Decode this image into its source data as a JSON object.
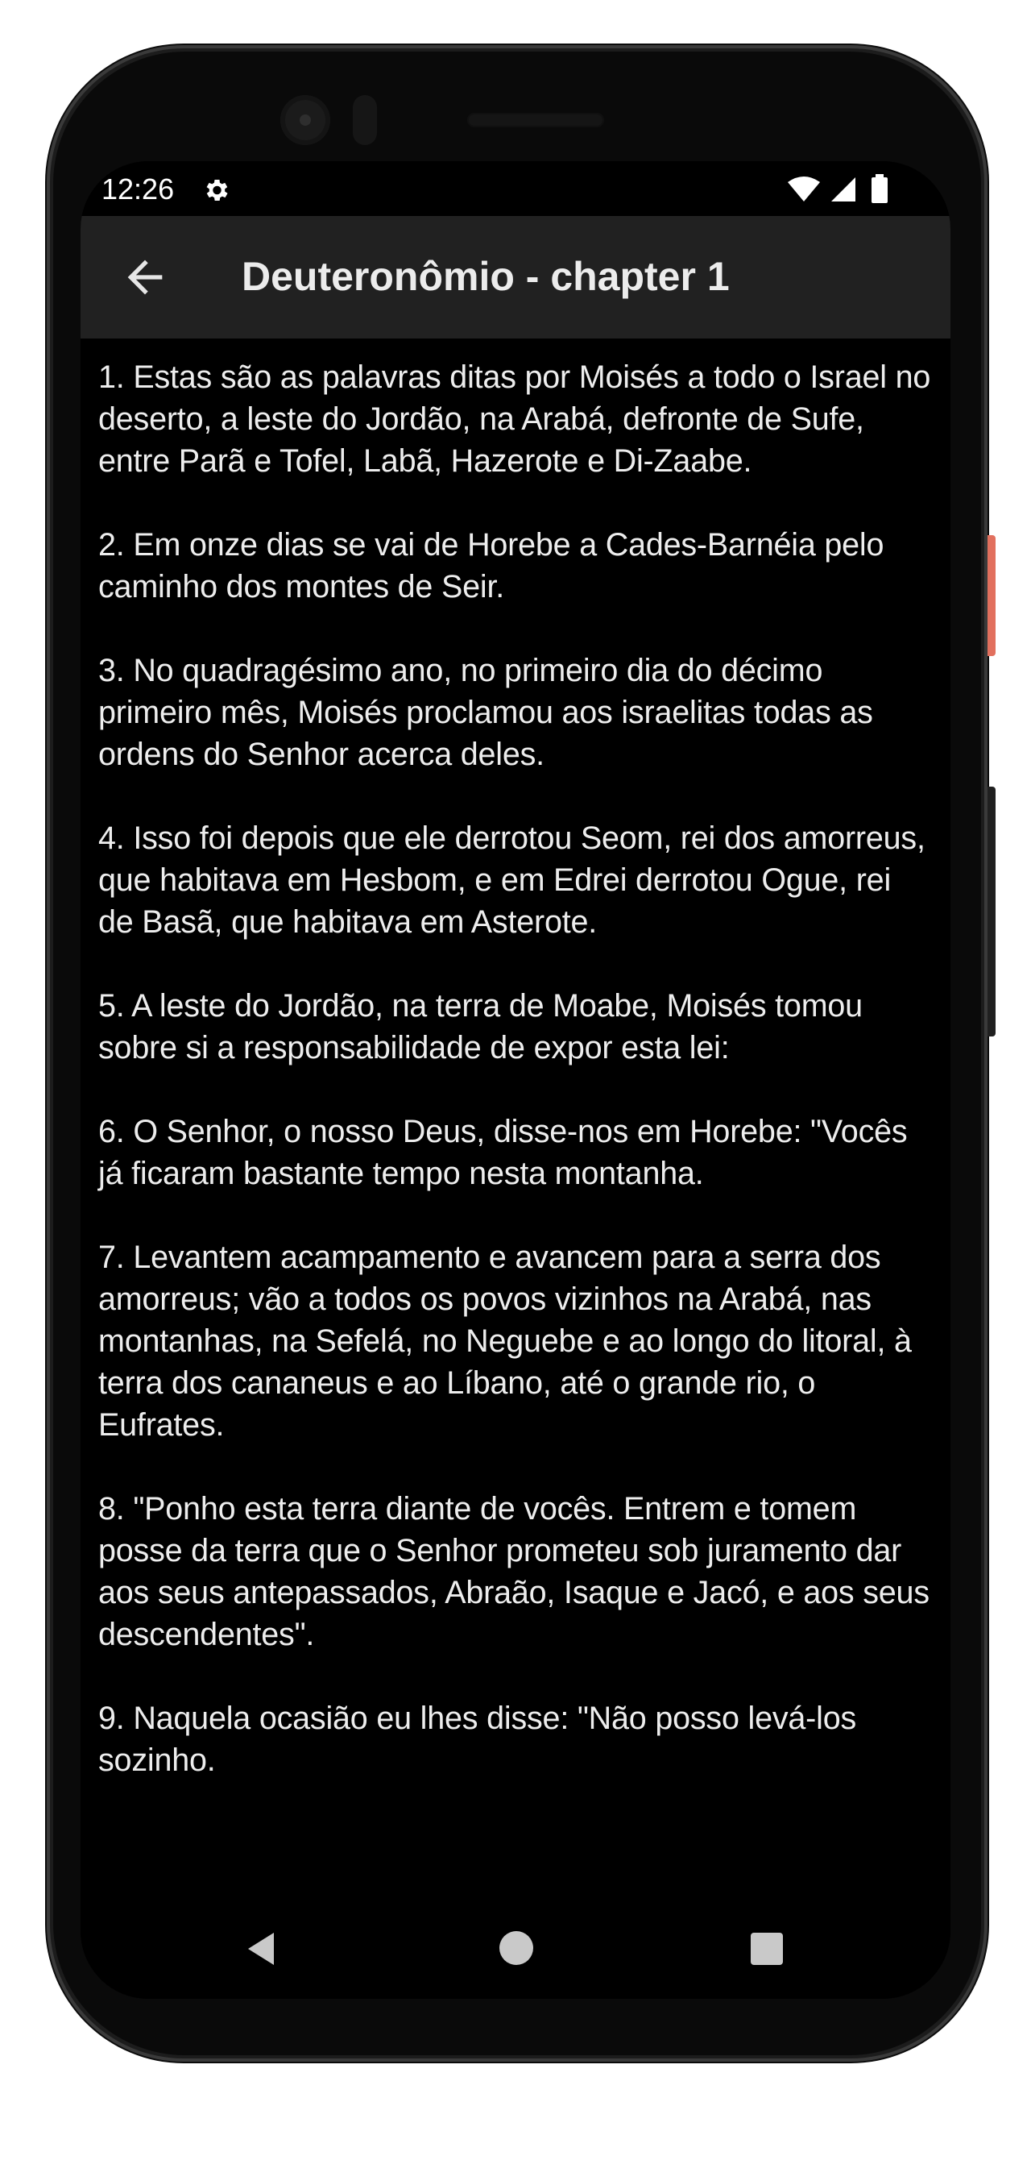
{
  "status_bar": {
    "time": "12:26",
    "icons": [
      "gear-icon",
      "wifi-icon",
      "signal-icon",
      "battery-icon"
    ]
  },
  "app_bar": {
    "back_icon": "arrow-left-icon",
    "title": "Deuteronômio - chapter 1"
  },
  "verses": [
    "1. Estas são as palavras ditas por Moisés a todo o Israel no deserto, a leste do Jordão, na Arabá, defronte de Sufe, entre Parã e Tofel, Labã, Hazerote e Di-Zaabe.",
    "2. Em onze dias se vai de Horebe a Cades-Barnéia pelo caminho dos montes de Seir.",
    "3. No quadragésimo ano, no primeiro dia do décimo primeiro mês, Moisés proclamou aos israelitas todas as ordens do Senhor acerca deles.",
    "4. Isso foi depois que ele derrotou Seom, rei dos amorreus, que habitava em Hesbom, e em Edrei derrotou Ogue, rei de Basã, que habitava em Asterote.",
    "5. A leste do Jordão, na terra de Moabe, Moisés tomou sobre si a responsabilidade de expor esta lei:",
    "6. O Senhor, o nosso Deus, disse-nos em Horebe: \"Vocês já ficaram bastante tempo nesta montanha.",
    "7. Levantem acampamento e avancem para a serra dos amorreus; vão a todos os povos vizinhos na Arabá, nas montanhas, na Sefelá, no Neguebe e ao longo do litoral, à terra dos cananeus e ao Líbano, até o grande rio, o Eufrates.",
    "8. \"Ponho esta terra diante de vocês. Entrem e tomem posse da terra que o Senhor prometeu sob juramento dar aos seus antepassados, Abraão, Isaque e Jacó, e aos seus descendentes\".",
    "9. Naquela ocasião eu lhes disse: \"Não posso levá-los sozinho."
  ],
  "nav_bar": {
    "icons": [
      "nav-back-icon",
      "nav-home-icon",
      "nav-recents-icon"
    ]
  },
  "colors": {
    "app_bar_bg": "#212121",
    "content_bg": "#000000",
    "text": "#ededed"
  }
}
